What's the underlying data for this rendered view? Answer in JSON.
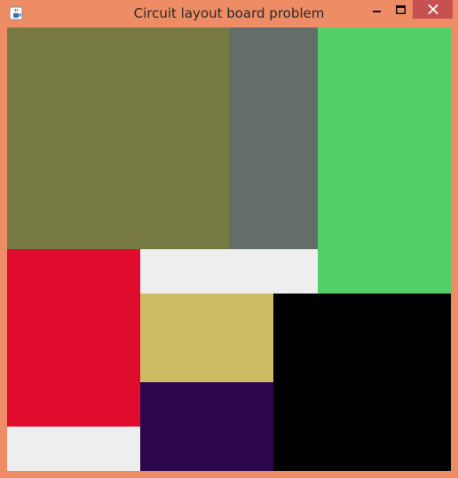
{
  "window": {
    "title": "Circuit layout board problem"
  },
  "icons": {
    "app": "java-cup-icon",
    "minimize": "minimize-icon",
    "maximize": "maximize-icon",
    "close": "close-icon"
  },
  "board": {
    "background": "#EEEEEE",
    "cells": [
      {
        "name": "olive-block",
        "color": "#777A42"
      },
      {
        "name": "gray-block",
        "color": "#646E69"
      },
      {
        "name": "green-block",
        "color": "#53CF67"
      },
      {
        "name": "red-block",
        "color": "#E00C2E"
      },
      {
        "name": "khaki-block",
        "color": "#CDBD62"
      },
      {
        "name": "purple-block",
        "color": "#2C064C"
      },
      {
        "name": "black-block",
        "color": "#000000"
      }
    ]
  }
}
